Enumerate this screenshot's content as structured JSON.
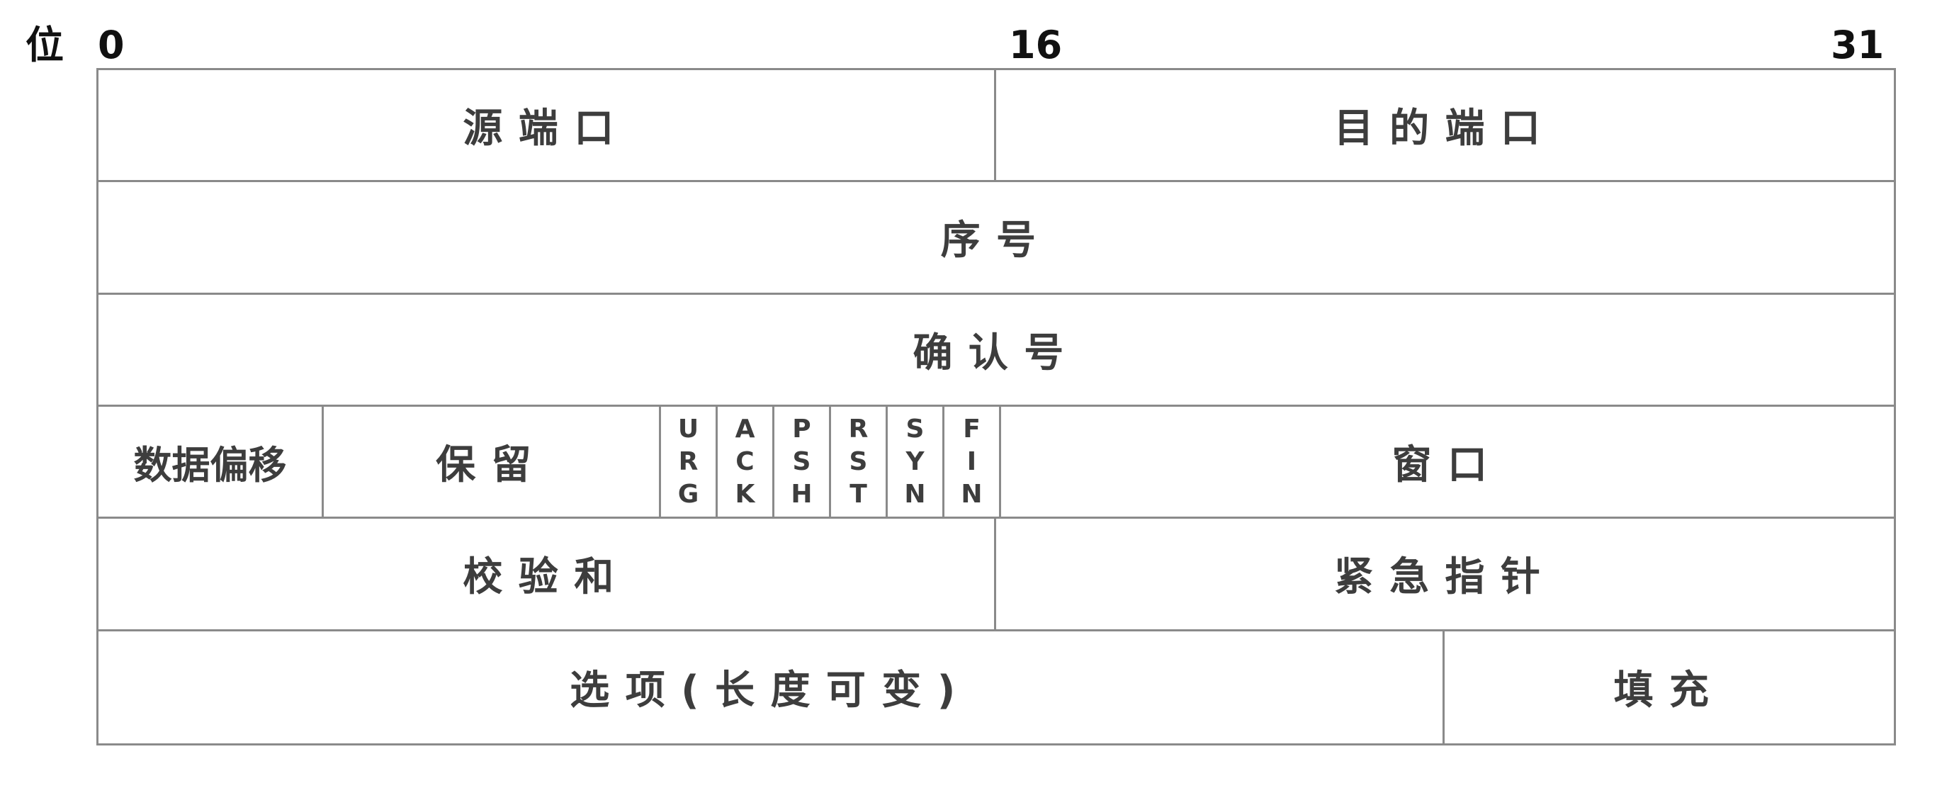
{
  "bits": {
    "title": "位",
    "start": "0",
    "middle": "16",
    "end": "31"
  },
  "rows": {
    "row1": {
      "source_port": "源端口",
      "dest_port": "目的端口"
    },
    "row2": {
      "sequence": "序号"
    },
    "row3": {
      "ack_number": "确认号"
    },
    "row4": {
      "data_offset": "数据偏移",
      "reserved": "保留",
      "flags": [
        {
          "letters": [
            "U",
            "R",
            "G"
          ]
        },
        {
          "letters": [
            "A",
            "C",
            "K"
          ]
        },
        {
          "letters": [
            "P",
            "S",
            "H"
          ]
        },
        {
          "letters": [
            "R",
            "S",
            "T"
          ]
        },
        {
          "letters": [
            "S",
            "Y",
            "N"
          ]
        },
        {
          "letters": [
            "F",
            "I",
            "N"
          ]
        }
      ],
      "window": "窗口"
    },
    "row5": {
      "checksum": "校验和",
      "urgent_pointer": "紧急指针"
    },
    "row6": {
      "options": "选项(长度可变)",
      "padding": "填充"
    }
  }
}
